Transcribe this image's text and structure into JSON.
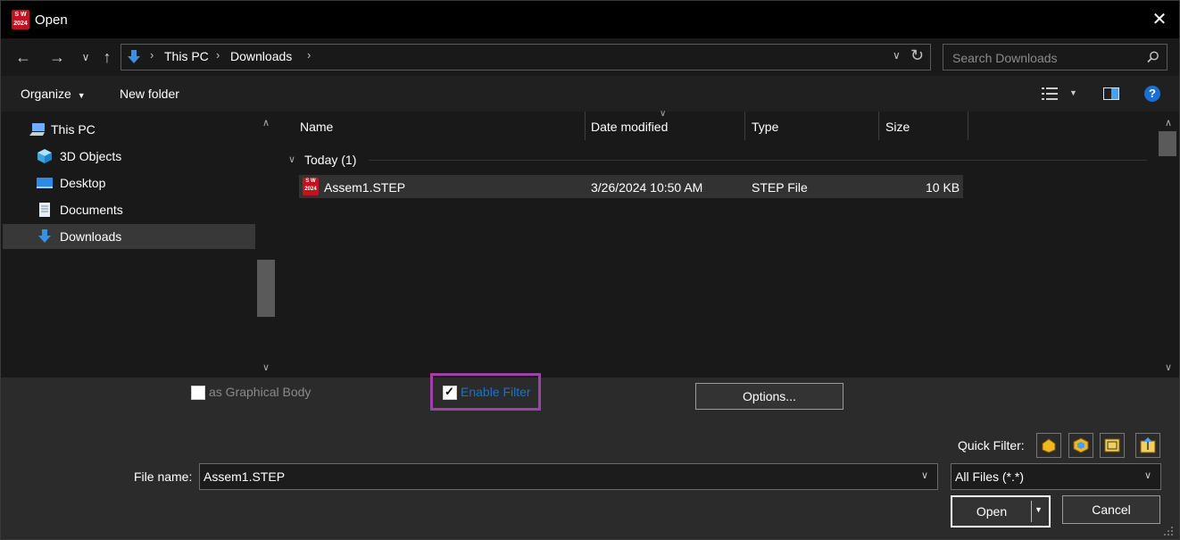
{
  "window": {
    "title": "Open",
    "app_logo_top": "S W",
    "app_logo_bottom": "2024"
  },
  "nav": {
    "path": [
      "This PC",
      "Downloads"
    ],
    "search_placeholder": "Search Downloads"
  },
  "toolbar": {
    "organize_label": "Organize",
    "new_folder_label": "New folder"
  },
  "sidebar": {
    "items": [
      {
        "label": "This PC",
        "icon": "computer-icon"
      },
      {
        "label": "3D Objects",
        "icon": "cube-icon"
      },
      {
        "label": "Desktop",
        "icon": "desktop-icon"
      },
      {
        "label": "Documents",
        "icon": "document-icon"
      },
      {
        "label": "Downloads",
        "icon": "download-arrow-icon",
        "selected": true
      }
    ]
  },
  "filelist": {
    "columns": [
      "Name",
      "Date modified",
      "Type",
      "Size"
    ],
    "group_label": "Today (1)",
    "rows": [
      {
        "name": "Assem1.STEP",
        "date": "3/26/2024 10:50 AM",
        "type": "STEP File",
        "size": "10 KB"
      }
    ]
  },
  "options": {
    "graphical_body_label": "as Graphical Body",
    "graphical_body_checked": false,
    "enable_filter_label": "Enable Filter",
    "enable_filter_checked": true,
    "options_button_label": "Options...",
    "highlight_color": "#a040a8",
    "link_color": "#1e6fd0"
  },
  "footer": {
    "quick_filter_label": "Quick Filter:",
    "file_name_label": "File name:",
    "file_name_value": "Assem1.STEP",
    "file_type_value": "All Files (*.*)",
    "open_label": "Open",
    "cancel_label": "Cancel"
  }
}
